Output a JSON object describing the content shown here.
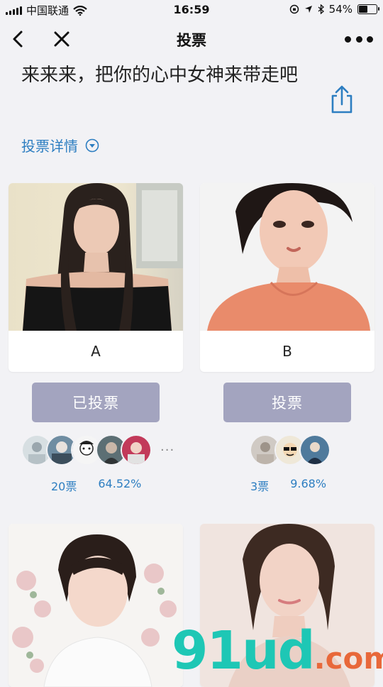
{
  "status_bar": {
    "carrier": "中国联通",
    "time": "16:59",
    "battery": "54%",
    "battery_level": 0.54
  },
  "nav": {
    "title": "投票"
  },
  "page": {
    "heading": "来来来，把你的心中女神来带走吧",
    "details_label": "投票详情"
  },
  "candidates": [
    {
      "name": "A",
      "vote_button": "已投票",
      "voted": true,
      "votes": "20票",
      "percent": "64.52%",
      "more_voters": "···"
    },
    {
      "name": "B",
      "vote_button": "投票",
      "voted": false,
      "votes": "3票",
      "percent": "9.68%"
    }
  ],
  "watermark": {
    "main": "91ud",
    "suffix": ".com"
  },
  "colors": {
    "accent": "#2d7ec1",
    "button": "#a3a4bf",
    "background": "#f2f2f5"
  }
}
